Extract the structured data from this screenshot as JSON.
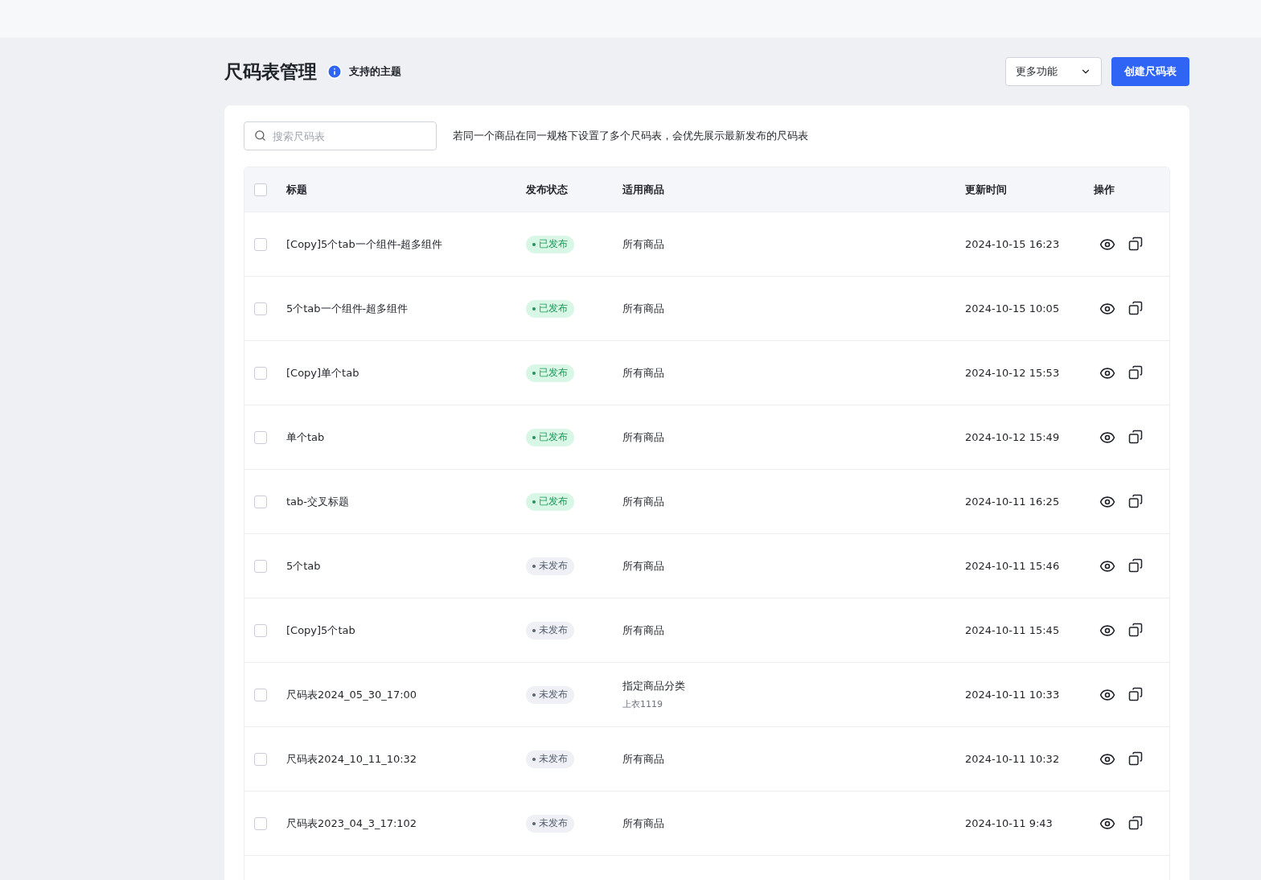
{
  "header": {
    "title": "尺码表管理",
    "info_link": "支持的主题",
    "more_menu": "更多功能",
    "create_button": "创建尺码表"
  },
  "search": {
    "placeholder": "搜索尺码表"
  },
  "notice": "若同一个商品在同一规格下设置了多个尺码表，会优先展示最新发布的尺码表",
  "table": {
    "select_all": {
      "checked": false
    },
    "columns": [
      "标题",
      "发布状态",
      "适用商品",
      "更新时间",
      "操作"
    ],
    "rows": [
      {
        "checked": false,
        "title": "[Copy]5个tab一个组件-超多组件",
        "status": {
          "kind": "published",
          "label": "已发布"
        },
        "goods": "所有商品",
        "updated": "2024-10-15 16:23"
      },
      {
        "checked": false,
        "title": "5个tab一个组件-超多组件",
        "status": {
          "kind": "published",
          "label": "已发布"
        },
        "goods": "所有商品",
        "updated": "2024-10-15 10:05"
      },
      {
        "checked": false,
        "title": "[Copy]单个tab",
        "status": {
          "kind": "published",
          "label": "已发布"
        },
        "goods": "所有商品",
        "updated": "2024-10-12 15:53"
      },
      {
        "checked": false,
        "title": "单个tab",
        "status": {
          "kind": "published",
          "label": "已发布"
        },
        "goods": "所有商品",
        "updated": "2024-10-12 15:49"
      },
      {
        "checked": false,
        "title": "tab-交叉标题",
        "status": {
          "kind": "published",
          "label": "已发布"
        },
        "goods": "所有商品",
        "updated": "2024-10-11 16:25"
      },
      {
        "checked": false,
        "title": "5个tab",
        "status": {
          "kind": "draft",
          "label": "未发布"
        },
        "goods": "所有商品",
        "updated": "2024-10-11 15:46"
      },
      {
        "checked": false,
        "title": "[Copy]5个tab",
        "status": {
          "kind": "draft",
          "label": "未发布"
        },
        "goods": "所有商品",
        "updated": "2024-10-11 15:45"
      },
      {
        "checked": false,
        "title": "尺码表2024_05_30_17:00",
        "status": {
          "kind": "draft",
          "label": "未发布"
        },
        "goods": "指定商品分类",
        "goods_detail": "上衣1119",
        "updated": "2024-10-11 10:33"
      },
      {
        "checked": false,
        "title": "尺码表2024_10_11_10:32",
        "status": {
          "kind": "draft",
          "label": "未发布"
        },
        "goods": "所有商品",
        "updated": "2024-10-11 10:32"
      },
      {
        "checked": false,
        "title": "尺码表2023_04_3_17:102",
        "status": {
          "kind": "draft",
          "label": "未发布"
        },
        "goods": "所有商品",
        "updated": "2024-10-11 9:43"
      }
    ]
  }
}
